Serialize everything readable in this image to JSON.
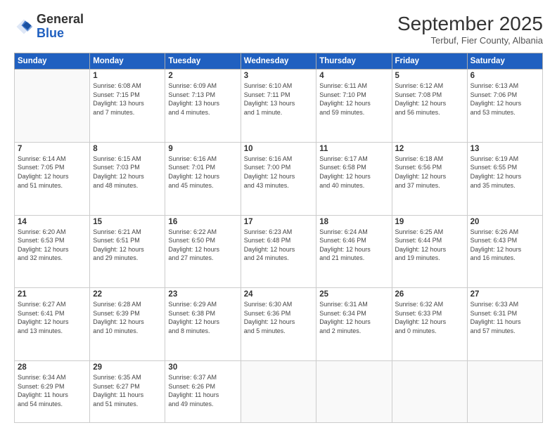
{
  "header": {
    "logo_general": "General",
    "logo_blue": "Blue",
    "month": "September 2025",
    "location": "Terbuf, Fier County, Albania"
  },
  "days_of_week": [
    "Sunday",
    "Monday",
    "Tuesday",
    "Wednesday",
    "Thursday",
    "Friday",
    "Saturday"
  ],
  "weeks": [
    [
      {
        "day": "",
        "info": ""
      },
      {
        "day": "1",
        "info": "Sunrise: 6:08 AM\nSunset: 7:15 PM\nDaylight: 13 hours\nand 7 minutes."
      },
      {
        "day": "2",
        "info": "Sunrise: 6:09 AM\nSunset: 7:13 PM\nDaylight: 13 hours\nand 4 minutes."
      },
      {
        "day": "3",
        "info": "Sunrise: 6:10 AM\nSunset: 7:11 PM\nDaylight: 13 hours\nand 1 minute."
      },
      {
        "day": "4",
        "info": "Sunrise: 6:11 AM\nSunset: 7:10 PM\nDaylight: 12 hours\nand 59 minutes."
      },
      {
        "day": "5",
        "info": "Sunrise: 6:12 AM\nSunset: 7:08 PM\nDaylight: 12 hours\nand 56 minutes."
      },
      {
        "day": "6",
        "info": "Sunrise: 6:13 AM\nSunset: 7:06 PM\nDaylight: 12 hours\nand 53 minutes."
      }
    ],
    [
      {
        "day": "7",
        "info": "Sunrise: 6:14 AM\nSunset: 7:05 PM\nDaylight: 12 hours\nand 51 minutes."
      },
      {
        "day": "8",
        "info": "Sunrise: 6:15 AM\nSunset: 7:03 PM\nDaylight: 12 hours\nand 48 minutes."
      },
      {
        "day": "9",
        "info": "Sunrise: 6:16 AM\nSunset: 7:01 PM\nDaylight: 12 hours\nand 45 minutes."
      },
      {
        "day": "10",
        "info": "Sunrise: 6:16 AM\nSunset: 7:00 PM\nDaylight: 12 hours\nand 43 minutes."
      },
      {
        "day": "11",
        "info": "Sunrise: 6:17 AM\nSunset: 6:58 PM\nDaylight: 12 hours\nand 40 minutes."
      },
      {
        "day": "12",
        "info": "Sunrise: 6:18 AM\nSunset: 6:56 PM\nDaylight: 12 hours\nand 37 minutes."
      },
      {
        "day": "13",
        "info": "Sunrise: 6:19 AM\nSunset: 6:55 PM\nDaylight: 12 hours\nand 35 minutes."
      }
    ],
    [
      {
        "day": "14",
        "info": "Sunrise: 6:20 AM\nSunset: 6:53 PM\nDaylight: 12 hours\nand 32 minutes."
      },
      {
        "day": "15",
        "info": "Sunrise: 6:21 AM\nSunset: 6:51 PM\nDaylight: 12 hours\nand 29 minutes."
      },
      {
        "day": "16",
        "info": "Sunrise: 6:22 AM\nSunset: 6:50 PM\nDaylight: 12 hours\nand 27 minutes."
      },
      {
        "day": "17",
        "info": "Sunrise: 6:23 AM\nSunset: 6:48 PM\nDaylight: 12 hours\nand 24 minutes."
      },
      {
        "day": "18",
        "info": "Sunrise: 6:24 AM\nSunset: 6:46 PM\nDaylight: 12 hours\nand 21 minutes."
      },
      {
        "day": "19",
        "info": "Sunrise: 6:25 AM\nSunset: 6:44 PM\nDaylight: 12 hours\nand 19 minutes."
      },
      {
        "day": "20",
        "info": "Sunrise: 6:26 AM\nSunset: 6:43 PM\nDaylight: 12 hours\nand 16 minutes."
      }
    ],
    [
      {
        "day": "21",
        "info": "Sunrise: 6:27 AM\nSunset: 6:41 PM\nDaylight: 12 hours\nand 13 minutes."
      },
      {
        "day": "22",
        "info": "Sunrise: 6:28 AM\nSunset: 6:39 PM\nDaylight: 12 hours\nand 10 minutes."
      },
      {
        "day": "23",
        "info": "Sunrise: 6:29 AM\nSunset: 6:38 PM\nDaylight: 12 hours\nand 8 minutes."
      },
      {
        "day": "24",
        "info": "Sunrise: 6:30 AM\nSunset: 6:36 PM\nDaylight: 12 hours\nand 5 minutes."
      },
      {
        "day": "25",
        "info": "Sunrise: 6:31 AM\nSunset: 6:34 PM\nDaylight: 12 hours\nand 2 minutes."
      },
      {
        "day": "26",
        "info": "Sunrise: 6:32 AM\nSunset: 6:33 PM\nDaylight: 12 hours\nand 0 minutes."
      },
      {
        "day": "27",
        "info": "Sunrise: 6:33 AM\nSunset: 6:31 PM\nDaylight: 11 hours\nand 57 minutes."
      }
    ],
    [
      {
        "day": "28",
        "info": "Sunrise: 6:34 AM\nSunset: 6:29 PM\nDaylight: 11 hours\nand 54 minutes."
      },
      {
        "day": "29",
        "info": "Sunrise: 6:35 AM\nSunset: 6:27 PM\nDaylight: 11 hours\nand 51 minutes."
      },
      {
        "day": "30",
        "info": "Sunrise: 6:37 AM\nSunset: 6:26 PM\nDaylight: 11 hours\nand 49 minutes."
      },
      {
        "day": "",
        "info": ""
      },
      {
        "day": "",
        "info": ""
      },
      {
        "day": "",
        "info": ""
      },
      {
        "day": "",
        "info": ""
      }
    ]
  ]
}
